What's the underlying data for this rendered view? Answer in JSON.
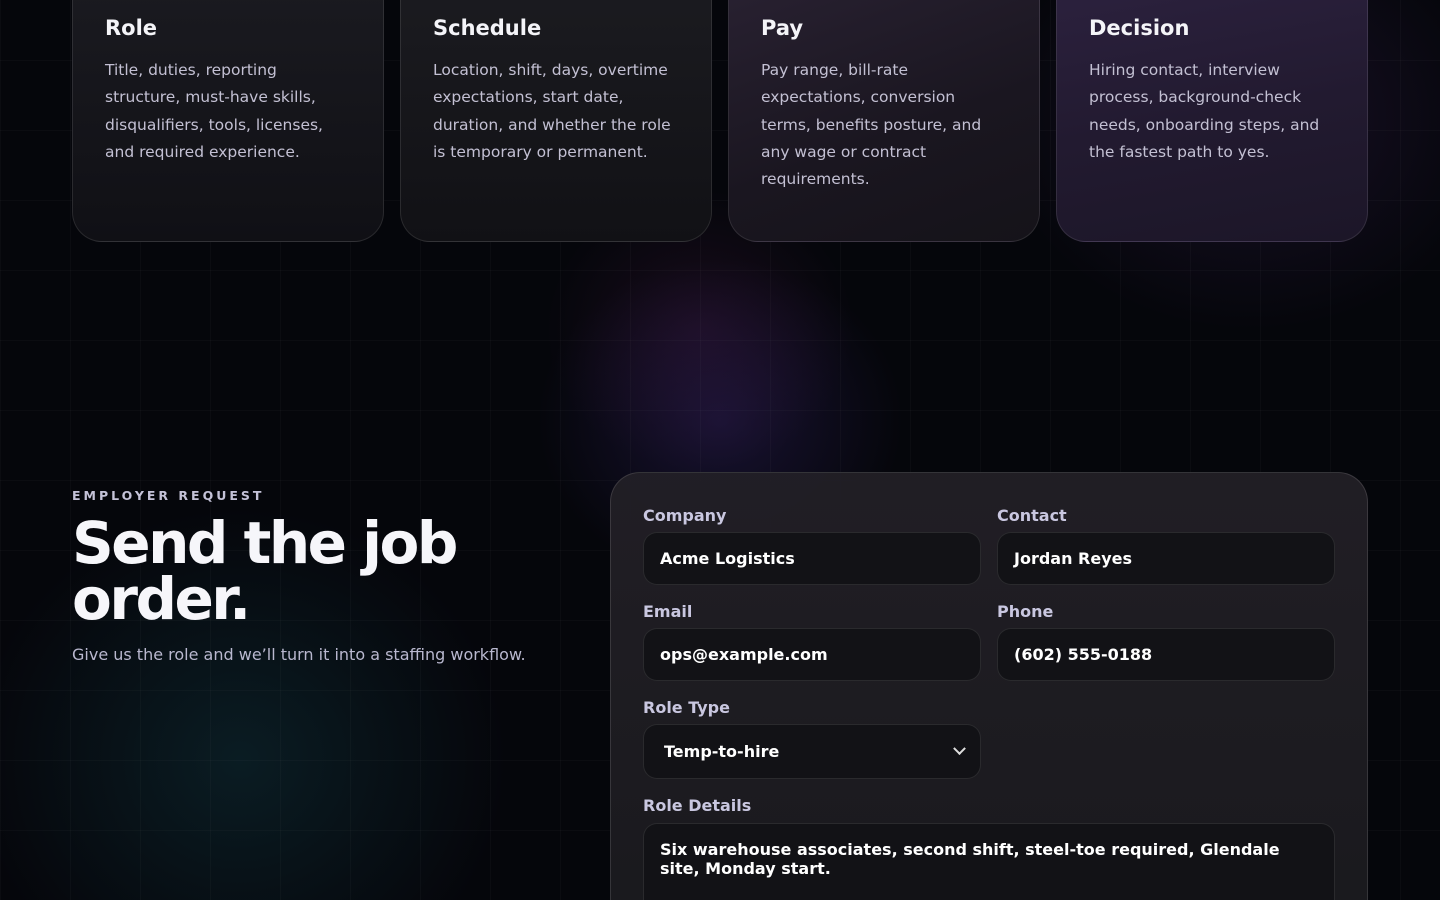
{
  "steps": [
    {
      "title": "Role",
      "text": "Title, duties, reporting structure, must-have skills, disqualifiers, tools, licenses, and required experience."
    },
    {
      "title": "Schedule",
      "text": "Location, shift, days, overtime expectations, start date, duration, and whether the role is temporary or permanent."
    },
    {
      "title": "Pay",
      "text": "Pay range, bill-rate expectations, conversion terms, benefits posture, and any wage or contract requirements."
    },
    {
      "title": "Decision",
      "text": "Hiring contact, interview process, background-check needs, onboarding steps, and the fastest path to yes."
    }
  ],
  "request": {
    "eyebrow": "EMPLOYER REQUEST",
    "headline": "Send the job order.",
    "subtitle": "Give us the role and we’ll turn it into a staffing workflow."
  },
  "form": {
    "company": {
      "label": "Company",
      "value": "Acme Logistics"
    },
    "contact": {
      "label": "Contact",
      "value": "Jordan Reyes"
    },
    "email": {
      "label": "Email",
      "value": "ops@example.com"
    },
    "phone": {
      "label": "Phone",
      "value": "(602) 555-0188"
    },
    "role_type": {
      "label": "Role Type",
      "value": "Temp-to-hire"
    },
    "role_details": {
      "label": "Role Details",
      "value": "Six warehouse associates, second shift, steel-toe required, Glendale site, Monday start."
    }
  }
}
